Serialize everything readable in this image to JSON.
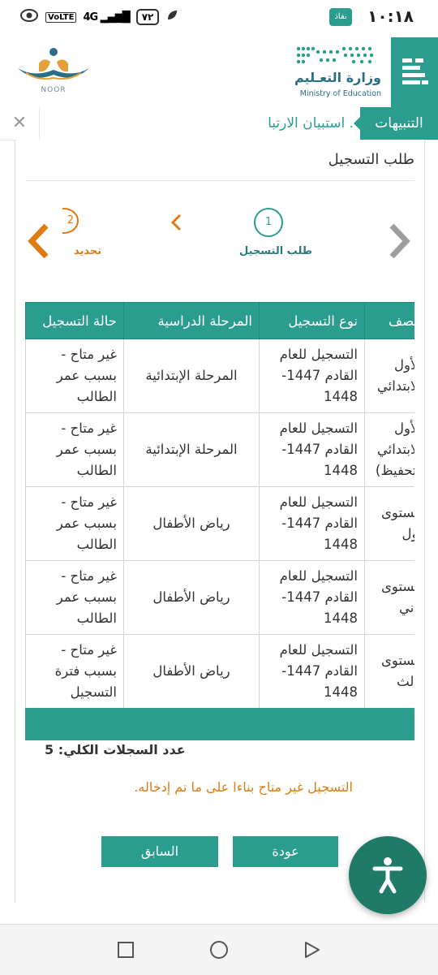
{
  "status_bar": {
    "time": "١٠:١٨",
    "carrier": "نفاذ",
    "network": "4G",
    "volte": "VoLTE",
    "battery": "٧٢"
  },
  "header": {
    "ministry_ar": "وزارة التعـليم",
    "ministry_en": "Ministry of Education",
    "noor_label": "NOOR",
    "accent_color": "#2a9d8f"
  },
  "alerts": {
    "label": "التنبيهات",
    "text": ". استبيان الارتبا",
    "close_icon": "close-icon"
  },
  "page": {
    "title": "طلب التسجيل"
  },
  "wizard": {
    "steps": [
      {
        "number": "1",
        "label": "طلب التسجيل"
      },
      {
        "number": "2",
        "label": "تحديد"
      }
    ]
  },
  "table": {
    "headers": [
      "الصف",
      "نوع التسجيل",
      "المرحلة الدراسية",
      "حالة التسجيل"
    ],
    "rows": [
      {
        "grade": "الأول الابتدائي",
        "type": "التسجيل للعام القادم 1447-1448",
        "stage": "المرحلة الإبتدائية",
        "status": "غير متاح - بسبب عمر الطالب"
      },
      {
        "grade": "الأول الابتدائي (تحفيظ)",
        "type": "التسجيل للعام القادم 1447-1448",
        "stage": "المرحلة الإبتدائية",
        "status": "غير متاح - بسبب عمر الطالب"
      },
      {
        "grade": "مستوى أول",
        "type": "التسجيل للعام القادم 1447-1448",
        "stage": "رياض الأطفال",
        "status": "غير متاح - بسبب عمر الطالب"
      },
      {
        "grade": "مستوى ثاني",
        "type": "التسجيل للعام القادم 1447-1448",
        "stage": "رياض الأطفال",
        "status": "غير متاح - بسبب عمر الطالب"
      },
      {
        "grade": "مستوى ثالث",
        "type": "التسجيل للعام القادم 1447-1448",
        "stage": "رياض الأطفال",
        "status": "غير متاح - بسبب فترة التسجيل"
      }
    ]
  },
  "summary": {
    "total_records": "عدد السجلات الكلي: 5"
  },
  "message": "التسجيل غير متاح بناءا على ما تم إدخاله.",
  "buttons": {
    "back": "عودة",
    "previous": "السابق"
  }
}
